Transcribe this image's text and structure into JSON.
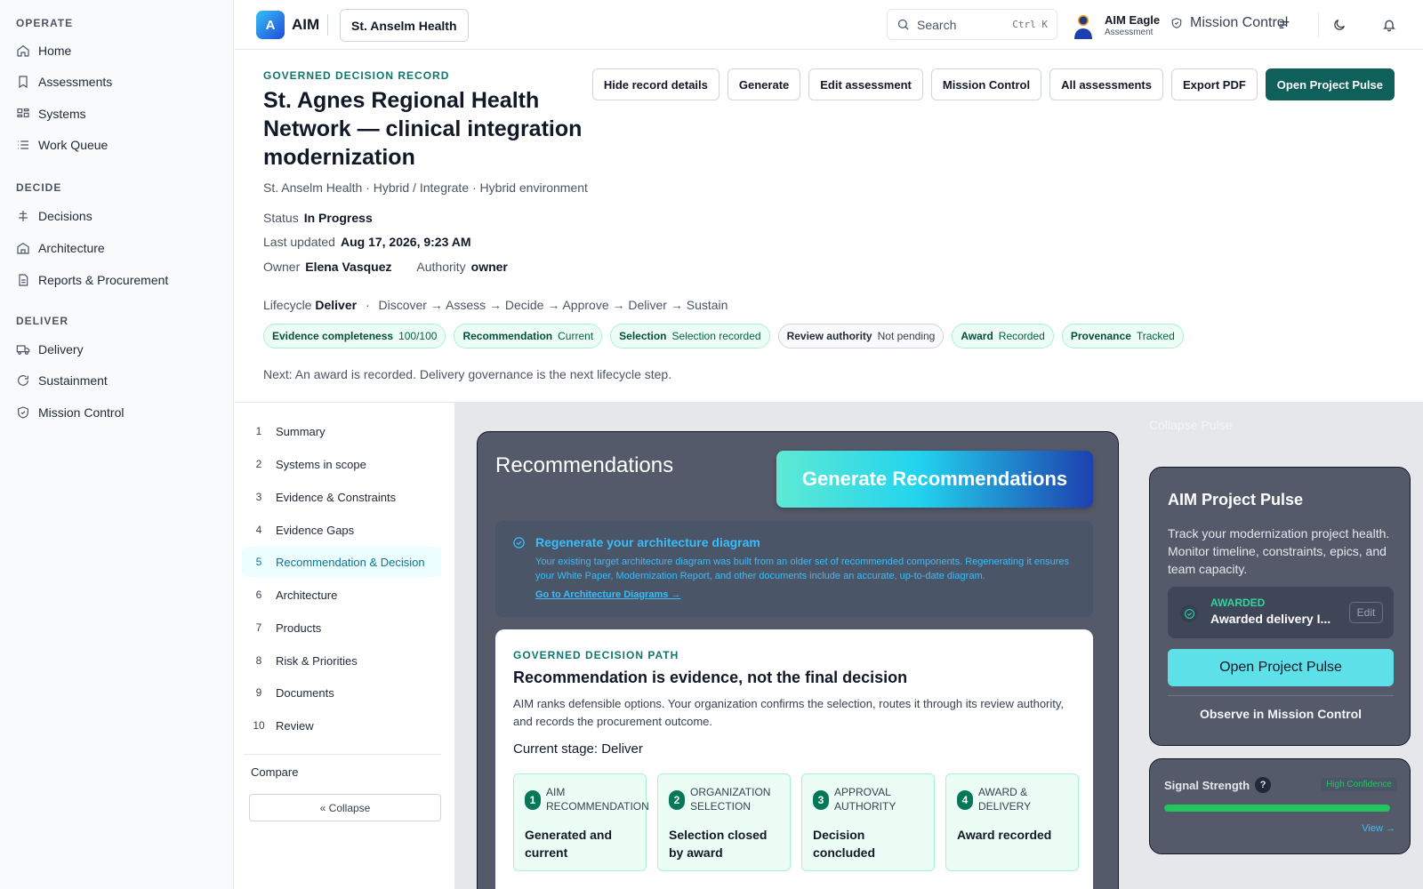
{
  "sidebar": {
    "sections": [
      {
        "title": "OPERATE",
        "items": [
          {
            "label": "Home",
            "icon": "home-icon"
          },
          {
            "label": "Assessments",
            "icon": "bookmark-icon"
          },
          {
            "label": "Systems",
            "icon": "grid-icon"
          },
          {
            "label": "Work Queue",
            "icon": "list-icon"
          }
        ]
      },
      {
        "title": "DECIDE",
        "items": [
          {
            "label": "Decisions",
            "icon": "scale-icon"
          },
          {
            "label": "Architecture",
            "icon": "building-icon"
          },
          {
            "label": "Reports & Procurement",
            "icon": "document-icon"
          }
        ]
      },
      {
        "title": "DELIVER",
        "items": [
          {
            "label": "Delivery",
            "icon": "truck-icon"
          },
          {
            "label": "Sustainment",
            "icon": "refresh-icon"
          },
          {
            "label": "Mission Control",
            "icon": "shield-icon"
          }
        ]
      }
    ]
  },
  "topbar": {
    "logo_letter": "A",
    "logo_text": "AIM",
    "org": "St. Anselm Health",
    "search_placeholder": "Search",
    "search_shortcut": "Ctrl K",
    "user_name": "AIM Eagle",
    "user_role": "Assessment",
    "mission_control": "Mission Control"
  },
  "record": {
    "eyebrow": "GOVERNED DECISION RECORD",
    "title": "St. Agnes Regional Health Network — clinical integration modernization",
    "subtitle": "St. Anselm Health · Hybrid / Integrate · Hybrid environment",
    "status_label": "Status",
    "status_value": "In Progress",
    "updated_label": "Last updated",
    "updated_value": "Aug 17, 2026, 9:23 AM",
    "owner_label": "Owner",
    "owner_value": "Elena Vasquez",
    "authority_label": "Authority",
    "authority_value": "owner",
    "lifecycle_label": "Lifecycle",
    "lifecycle_value": "Deliver",
    "lifecycle_path": "Discover → Assess → Decide → Approve → Deliver → Sustain",
    "chips": [
      {
        "label": "Evidence completeness",
        "value": "100/100"
      },
      {
        "label": "Recommendation",
        "value": "Current"
      },
      {
        "label": "Selection",
        "value": "Selection recorded"
      },
      {
        "label": "Review authority",
        "value": "Not pending"
      },
      {
        "label": "Award",
        "value": "Recorded"
      },
      {
        "label": "Provenance",
        "value": "Tracked"
      }
    ],
    "next": "Next: An award is recorded. Delivery governance is the next lifecycle step.",
    "actions": [
      "Hide record details",
      "Generate",
      "Edit assessment",
      "Mission Control",
      "All assessments",
      "Export PDF"
    ],
    "primary_action": "Open Project Pulse"
  },
  "steps": {
    "items": [
      {
        "num": "1",
        "label": "Summary"
      },
      {
        "num": "2",
        "label": "Systems in scope"
      },
      {
        "num": "3",
        "label": "Evidence & Constraints"
      },
      {
        "num": "4",
        "label": "Evidence Gaps"
      },
      {
        "num": "5",
        "label": "Recommendation & Decision"
      },
      {
        "num": "6",
        "label": "Architecture"
      },
      {
        "num": "7",
        "label": "Products"
      },
      {
        "num": "8",
        "label": "Risk & Priorities"
      },
      {
        "num": "9",
        "label": "Documents"
      },
      {
        "num": "10",
        "label": "Review"
      }
    ],
    "active_index": 4,
    "compare": "Compare",
    "collapse": "« Collapse"
  },
  "recommendations": {
    "title": "Recommendations",
    "generate_button": "Generate Recommendations",
    "regen_title": "Regenerate your architecture diagram",
    "regen_body": "Your existing target architecture diagram was built from an older set of recommended components. Regenerating it ensures your White Paper, Modernization Report, and other documents include an accurate, up-to-date diagram.",
    "regen_link": "Go to Architecture Diagrams →",
    "path_eyebrow": "GOVERNED DECISION PATH",
    "path_title": "Recommendation is evidence, not the final decision",
    "path_body": "AIM ranks defensible options. Your organization confirms the selection, routes it through its review authority, and records the procurement outcome.",
    "current_stage": "Current stage: Deliver",
    "stages": [
      {
        "num": "1",
        "label": "AIM RECOMMENDATION",
        "value": "Generated and current"
      },
      {
        "num": "2",
        "label": "ORGANIZATION SELECTION",
        "value": "Selection closed by award"
      },
      {
        "num": "3",
        "label": "APPROVAL AUTHORITY",
        "value": "Decision concluded"
      },
      {
        "num": "4",
        "label": "AWARD & DELIVERY",
        "value": "Award recorded"
      }
    ]
  },
  "pulse": {
    "collapse": "Collapse Pulse",
    "title": "AIM Project Pulse",
    "body": "Track your modernization project health. Monitor timeline, constraints, epics, and team capacity.",
    "awarded_label": "AWARDED",
    "awarded_value": "Awarded delivery I...",
    "edit": "Edit",
    "open": "Open Project Pulse",
    "observe": "Observe in Mission Control",
    "signal_title": "Signal Strength",
    "signal_help": "?",
    "signal_badge": "High Confidence",
    "signal_level": 1.0,
    "signal_view": "View →"
  }
}
